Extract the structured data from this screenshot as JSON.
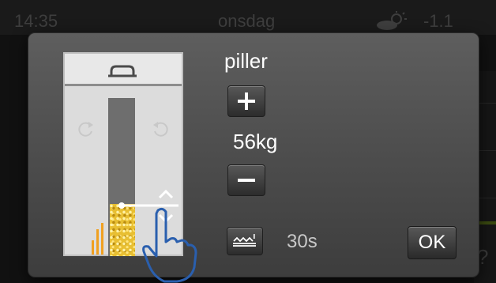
{
  "status_bar": {
    "time": "14:35",
    "day": "onsdag",
    "weather_icon": "partly-sunny-icon",
    "temperature": "-1.1"
  },
  "dialog": {
    "product_label": "piller",
    "weight_value": "56kg",
    "interval_value": "30s",
    "ok_label": "OK",
    "icons": {
      "plus": "plus-icon",
      "minus": "minus-icon",
      "flow": "conveyor-flow-icon",
      "silo": "pellet-silo-illustration",
      "hand": "touch-hand-icon"
    }
  },
  "colors": {
    "dialog_bg": "#4d4d4d",
    "pellet": "#e8bf32",
    "hand_outline": "#2a5fae"
  }
}
